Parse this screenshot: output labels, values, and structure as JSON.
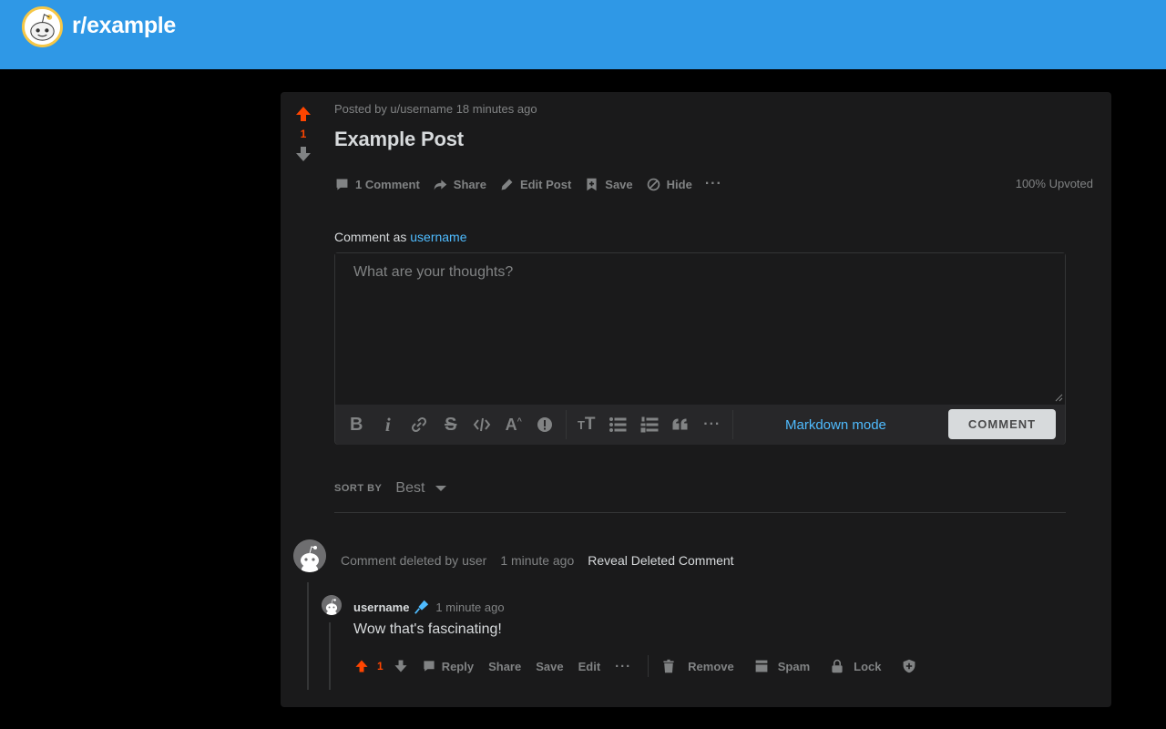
{
  "header": {
    "subreddit": "r/example",
    "logo_icon": "reddit-snoo-logo-icon",
    "bg_color": "#2f98e6"
  },
  "post": {
    "meta": "Posted by u/username 18 minutes ago",
    "title": "Example Post",
    "score": "1",
    "actions": {
      "comments": "1 Comment",
      "share": "Share",
      "edit": "Edit Post",
      "save": "Save",
      "hide": "Hide",
      "more": "···"
    },
    "upvoted": "100% Upvoted"
  },
  "composer": {
    "comment_as_prefix": "Comment as",
    "username": "username",
    "placeholder": "What are your thoughts?",
    "markdown_mode": "Markdown mode",
    "submit": "COMMENT",
    "toolbar_icons": [
      "bold-icon",
      "italic-icon",
      "link-icon",
      "strikethrough-icon",
      "code-icon",
      "superscript-icon",
      "spoiler-icon",
      "heading-icon",
      "bulleted-list-icon",
      "numbered-list-icon",
      "quote-block-icon",
      "more-icon"
    ]
  },
  "sort": {
    "label": "SORT BY",
    "value": "Best"
  },
  "comments": {
    "deleted": {
      "text": "Comment deleted by user",
      "time": "1 minute ago",
      "reveal": "Reveal Deleted Comment"
    },
    "reply": {
      "user": "username",
      "time": "1 minute ago",
      "body": "Wow that's fascinating!",
      "score": "1",
      "actions": {
        "reply": "Reply",
        "share": "Share",
        "save": "Save",
        "edit": "Edit",
        "more": "···",
        "remove": "Remove",
        "spam": "Spam",
        "lock": "Lock"
      }
    }
  },
  "colors": {
    "accent": "#ff4500",
    "link": "#4fbcff",
    "card": "#1a1a1b"
  }
}
